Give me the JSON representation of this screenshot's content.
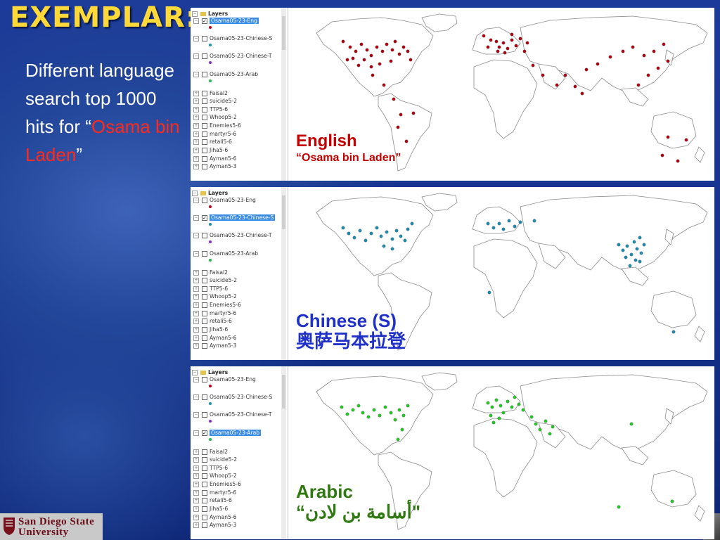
{
  "slide": {
    "title": "EXEMPLAR:",
    "bullet_pre": "Different language search top 1000 hits for “",
    "bullet_red": "Osama bin Laden",
    "bullet_post": "”",
    "logo_line1": "San Diego State",
    "logo_line2": "University"
  },
  "layers": {
    "header": "Layers",
    "items": [
      "Osama05-23-Eng",
      "Osama05-23-Chinese-S",
      "Osama05-23-Chinese-T",
      "Osama05-23-Arab",
      "Faisal2",
      "suicide5-2",
      "TTP5-6",
      "Whoop5-2",
      "Enemies5-6",
      "martyr5-6",
      "retali5-6",
      "Jiha5-6",
      "Ayman5-6",
      "Ayman5-3"
    ]
  },
  "panels": [
    {
      "caption": "English",
      "subcaption": "“Osama bin Laden”",
      "color": "#b3000f",
      "caption_color": "#c40000",
      "selected_index": 0
    },
    {
      "caption": "Chinese (S)",
      "subcaption": "奥萨马本拉登",
      "color": "#1a8fb6",
      "caption_color": "#1f31c9",
      "selected_index": 1
    },
    {
      "caption": "Arabic",
      "subcaption": "“أسامة بن لادن\"",
      "color": "#1fd11f",
      "caption_color": "#2e7a10",
      "selected_index": 3
    }
  ],
  "colors": {
    "title": "#ffd83a",
    "highlight": "#ff2a1a",
    "eng_symbol": "#c0001a",
    "chs_symbol": "#1a8fb6",
    "cht_symbol": "#8b2bd6",
    "arab_symbol": "#1fb84a"
  }
}
